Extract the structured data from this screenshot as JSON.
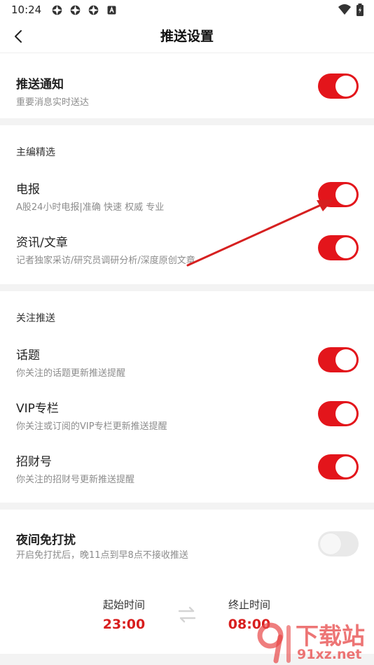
{
  "status_bar": {
    "time": "10:24",
    "icons": [
      "app-notification-icon",
      "app-notification-icon",
      "app-notification-icon",
      "a-letter-icon"
    ],
    "right_icons": [
      "wifi-icon",
      "battery-icon"
    ]
  },
  "nav": {
    "title": "推送设置",
    "back_icon": "chevron-left-icon"
  },
  "push_notice": {
    "title": "推送通知",
    "subtitle": "重要消息实时送达",
    "on": true
  },
  "editor_picks": {
    "label": "主编精选",
    "items": [
      {
        "title": "电报",
        "subtitle": "A股24小时电报|准确 快速 权威 专业",
        "on": true
      },
      {
        "title": "资讯/文章",
        "subtitle": "记者独家采访/研究员调研分析/深度原创文章",
        "on": true
      }
    ]
  },
  "follow_push": {
    "label": "关注推送",
    "items": [
      {
        "title": "话题",
        "subtitle": "你关注的话题更新推送提醒",
        "on": true
      },
      {
        "title": "VIP专栏",
        "subtitle": "你关注或订阅的VIP专栏更新推送提醒",
        "on": true
      },
      {
        "title": "招财号",
        "subtitle": "你关注的招财号更新推送提醒",
        "on": true
      }
    ]
  },
  "night_mode": {
    "title": "夜间免打扰",
    "subtitle": "开启免打扰后，晚11点到早8点不接收推送",
    "on": false,
    "start_label": "起始时间",
    "start_value": "23:00",
    "end_label": "终止时间",
    "end_value": "08:00"
  },
  "watermark": {
    "big": "下载站",
    "small": "91xz.net"
  },
  "colors": {
    "accent": "#e3151b",
    "time_value": "#d81e1e",
    "annotation_arrow": "#d62020"
  }
}
